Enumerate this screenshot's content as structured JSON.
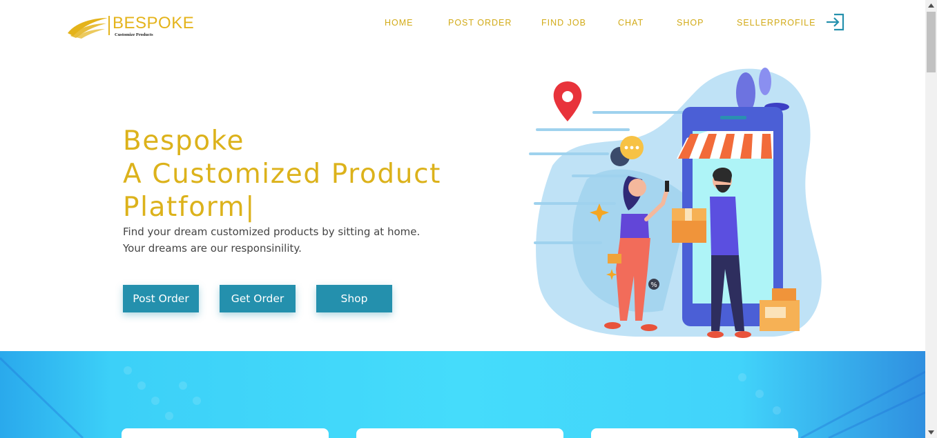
{
  "brand": {
    "name": "BESPOKE",
    "tagline": "Customize Products",
    "color": "#e4b31a"
  },
  "nav": {
    "items": [
      "HOME",
      "POST ORDER",
      "FIND JOB",
      "CHAT",
      "SHOP",
      "SELLERPROFILE"
    ],
    "login_icon": "sign-in-icon"
  },
  "hero": {
    "title_line1": "Bespoke",
    "title_line2": "A Customized Product",
    "title_line3": "Platform|",
    "text_line1": "Find your dream customized products by sitting at home.",
    "text_line2": "Your dreams are our responsinility.",
    "buttons": [
      "Post Order",
      "Get Order",
      "Shop"
    ],
    "accent": "#2490ad"
  },
  "illustration": {
    "icons": [
      "location-pin-icon",
      "chat-bubble-icon",
      "shop-awning-icon",
      "package-icon",
      "percent-icon"
    ]
  }
}
